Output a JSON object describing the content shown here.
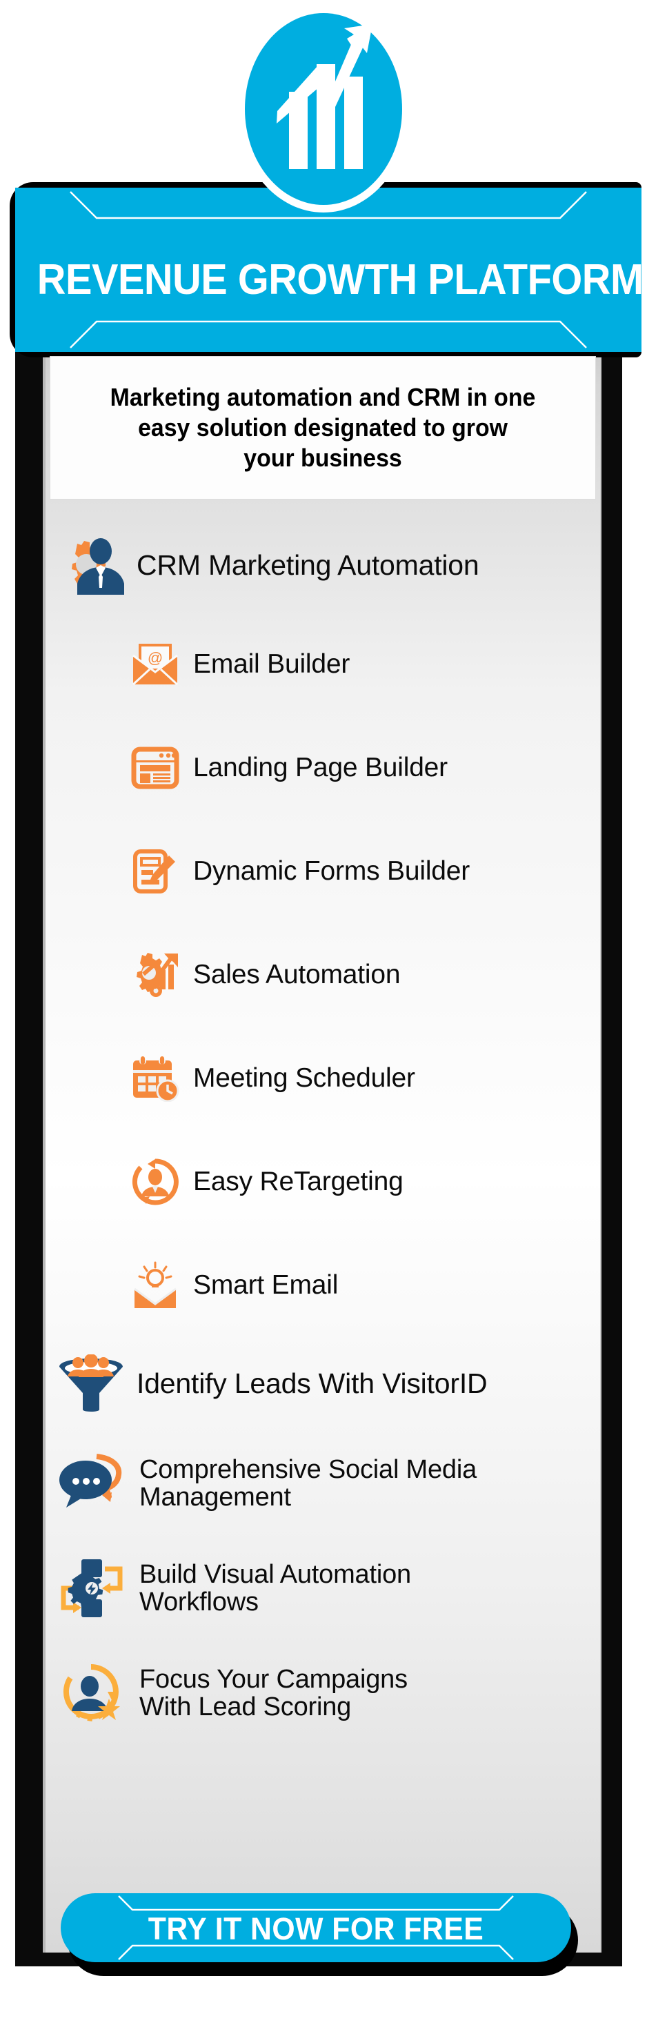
{
  "brand": {
    "cyan": "#00AEE0",
    "orange": "#F5893C",
    "orange_light": "#FBAE3C",
    "navy": "#1F4E79",
    "black": "#000000",
    "white": "#FFFFFF"
  },
  "logo": {
    "icon": "growth-bar-chart-arrow-icon"
  },
  "header": {
    "title": "REVENUE GROWTH PLATFORM"
  },
  "subtitle": {
    "text": "Marketing automation and CRM in one\neasy solution designated to grow\nyour  business"
  },
  "features": [
    {
      "level": "main",
      "icon": "crm-gear-person-icon",
      "label": "CRM Marketing Automation"
    },
    {
      "level": "sub",
      "icon": "email-envelope-at-icon",
      "label": "Email Builder"
    },
    {
      "level": "sub",
      "icon": "landing-page-browser-icon",
      "label": "Landing Page Builder"
    },
    {
      "level": "sub",
      "icon": "form-pencil-icon",
      "label": "Dynamic Forms Builder"
    },
    {
      "level": "sub",
      "icon": "sales-gears-chart-icon",
      "label": "Sales Automation"
    },
    {
      "level": "sub",
      "icon": "calendar-clock-icon",
      "label": "Meeting Scheduler"
    },
    {
      "level": "sub",
      "icon": "retargeting-person-loop-icon",
      "label": "Easy ReTargeting"
    },
    {
      "level": "sub",
      "icon": "smart-email-bulb-icon",
      "label": "Smart Email"
    },
    {
      "level": "main",
      "icon": "lead-funnel-people-icon",
      "label": "Identify Leads With VisitorID"
    },
    {
      "level": "main2",
      "icon": "social-chat-bubble-icon",
      "label": "Comprehensive Social Media\nManagement"
    },
    {
      "level": "main2",
      "icon": "workflow-gear-arrows-icon",
      "label": "Build Visual Automation\n Workflows"
    },
    {
      "level": "main2",
      "icon": "lead-scoring-star-person-icon",
      "label": "Focus Your Campaigns\nWith Lead Scoring"
    }
  ],
  "cta": {
    "label": "TRY IT NOW FOR FREE"
  }
}
